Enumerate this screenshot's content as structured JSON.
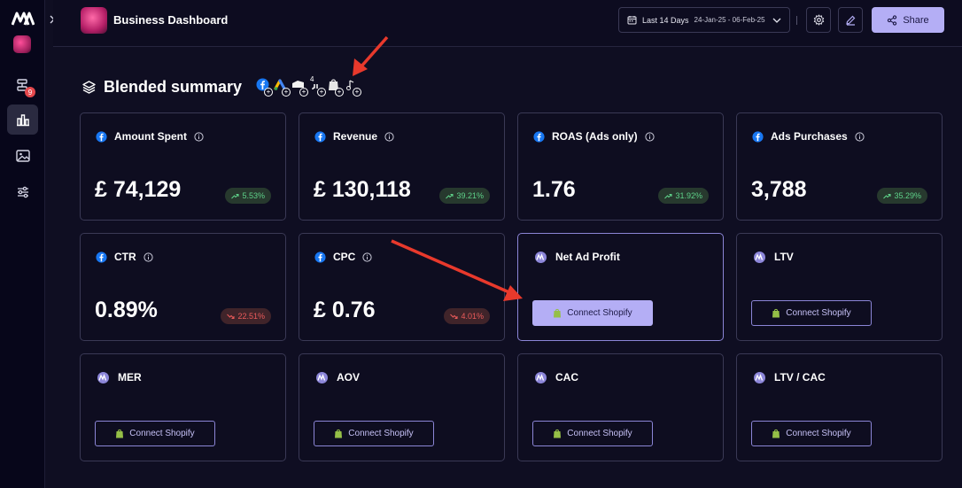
{
  "header": {
    "title": "Business Dashboard",
    "date_label": "Last 14 Days",
    "date_range": "24-Jan-25 - 06-Feb-25",
    "share_label": "Share"
  },
  "sidebar": {
    "badge_count": "9"
  },
  "summary": {
    "title": "Blended summary",
    "integration_note": "4"
  },
  "cards": [
    {
      "label": "Amount Spent",
      "value": "£ 74,129",
      "change": "5.53%",
      "trend": "up"
    },
    {
      "label": "Revenue",
      "value": "£ 130,118",
      "change": "39.21%",
      "trend": "up"
    },
    {
      "label": "ROAS (Ads only)",
      "value": "1.76",
      "change": "31.92%",
      "trend": "up"
    },
    {
      "label": "Ads Purchases",
      "value": "3,788",
      "change": "35.29%",
      "trend": "up"
    },
    {
      "label": "CTR",
      "value": "0.89%",
      "change": "22.51%",
      "trend": "down"
    },
    {
      "label": "CPC",
      "value": "£ 0.76",
      "change": "4.01%",
      "trend": "down"
    },
    {
      "label": "Net Ad Profit",
      "connect": "Connect Shopify"
    },
    {
      "label": "LTV",
      "connect": "Connect Shopify"
    },
    {
      "label": "MER",
      "connect": "Connect Shopify"
    },
    {
      "label": "AOV",
      "connect": "Connect Shopify"
    },
    {
      "label": "CAC",
      "connect": "Connect Shopify"
    },
    {
      "label": "LTV / CAC",
      "connect": "Connect Shopify"
    }
  ],
  "colors": {
    "accent": "#b4aef5",
    "positive": "#5fd38a",
    "negative": "#ec5b5b",
    "annotation_arrow": "#e8392c"
  },
  "icons": [
    "facebook-icon",
    "info-icon",
    "brand-m-icon",
    "shopify-icon",
    "calendar-icon",
    "gear-icon",
    "edit-icon",
    "share-icon",
    "layers-icon"
  ]
}
